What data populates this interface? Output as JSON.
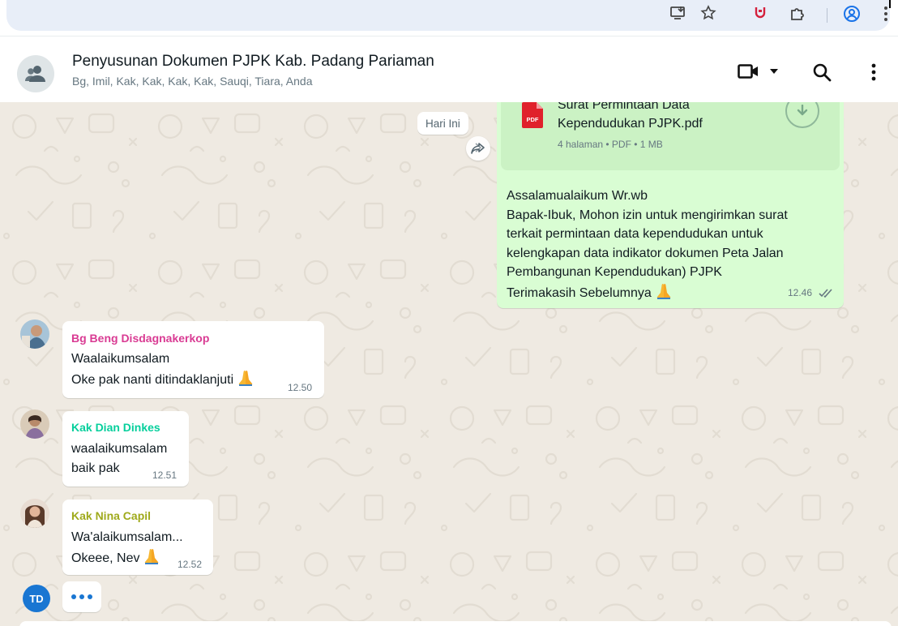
{
  "colors": {
    "outgoing_bubble": "#d9fdd3",
    "incoming_bubble": "#ffffff",
    "chat_background": "#efeae2",
    "read_ticks": "#667781",
    "sender_1": "#d93b93",
    "sender_2": "#06cf9c",
    "sender_3": "#9faa1b",
    "typing_accent": "#1976d2"
  },
  "browser": {
    "icons": [
      "install-app-icon",
      "bookmark-star-icon",
      "extension-red-icon",
      "extensions-puzzle-icon",
      "profile-icon",
      "browser-menu-icon"
    ]
  },
  "header": {
    "group_icon": "group-icon",
    "title": "Penyusunan Dokumen PJPK Kab. Padang Pariaman",
    "members": "Bg, Imil, Kak, Kak, Kak, Kak, Sauqi, Tiara, Anda",
    "actions": [
      "video-call-icon",
      "dropdown-caret-icon",
      "search-icon",
      "menu-icon"
    ]
  },
  "chat": {
    "date_label": "Hari Ini",
    "forward_icon": "forward-icon",
    "outgoing": {
      "document": {
        "file_name_line1": "Surat Permintaan Data",
        "file_name_line2": "Kependudukan PJPK.pdf",
        "meta": "4 halaman • PDF • 1 MB",
        "icon": "pdf-icon",
        "pdf_badge": "PDF",
        "download_icon": "download-icon"
      },
      "lines": [
        "Assalamualaikum Wr.wb",
        "Bapak-Ibuk, Mohon izin untuk mengirimkan surat",
        "terkait permintaan data kependudukan untuk",
        "kelengkapan data indikator dokumen Peta Jalan",
        "Pembangunan Kependudukan) PJPK",
        "Terimakasih Sebelumnya"
      ],
      "emoji": "folded-hands-emoji",
      "time": "12.46",
      "status_icon": "double-check-icon"
    },
    "messages": [
      {
        "sender": "Bg Beng Disdagnakerkop",
        "lines": [
          "Waalaikumsalam",
          "Oke pak nanti ditindaklanjuti"
        ],
        "emoji": "folded-hands-emoji",
        "time": "12.50"
      },
      {
        "sender": "Kak Dian Dinkes",
        "lines": [
          "waalaikumsalam",
          "baik pak"
        ],
        "time": "12.51"
      },
      {
        "sender": "Kak Nina Capil",
        "lines": [
          "Wa'alaikumsalam...",
          "Okeee, Nev"
        ],
        "emoji": "folded-hands-emoji",
        "time": "12.52"
      }
    ],
    "typing": {
      "initials": "TD"
    }
  }
}
